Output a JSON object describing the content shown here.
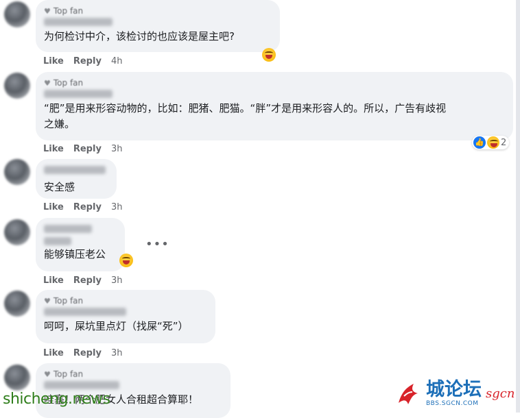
{
  "actions": {
    "like": "Like",
    "reply": "Reply"
  },
  "comments": [
    {
      "badge": "Top fan",
      "text": "为何检讨中介，该检讨的也应该是屋主吧?",
      "time": "4h"
    },
    {
      "badge": "Top fan",
      "text": "“肥”是用来形容动物的，比如：肥猪、肥猫。“胖”才是用来形容人的。所以，广告有歧视\n之嫌。",
      "time": "3h",
      "reaction_count": "2"
    },
    {
      "badge": "",
      "text": "安全感",
      "time": "3h"
    },
    {
      "badge": "",
      "text": "能够镇压老公",
      "time": "3h"
    },
    {
      "badge": "Top fan",
      "text": "呵呵，屎坑里点灯（找屎“死”）",
      "time": "3h"
    },
    {
      "badge": "Top fan",
      "text": "哇塞！两个肥女人合租超合算耶！",
      "time": ""
    }
  ],
  "watermark": {
    "left": "shicheng.news",
    "logo_cn": "城论坛",
    "logo_sub": "BBS.SGCN.COM",
    "logo_red": "sgcn"
  },
  "icons": {
    "more": "more-horizontal-icon",
    "badge": "top-fan-badge-icon",
    "like": "like-reaction-icon",
    "haha": "haha-reaction-icon"
  },
  "colors": {
    "bubble": "#f0f2f5",
    "action": "#65676b",
    "like_blue": "#1877f2",
    "watermark_green": "#2e7d1a",
    "watermark_blue": "#1d6fb8",
    "watermark_red": "#d8232a"
  }
}
